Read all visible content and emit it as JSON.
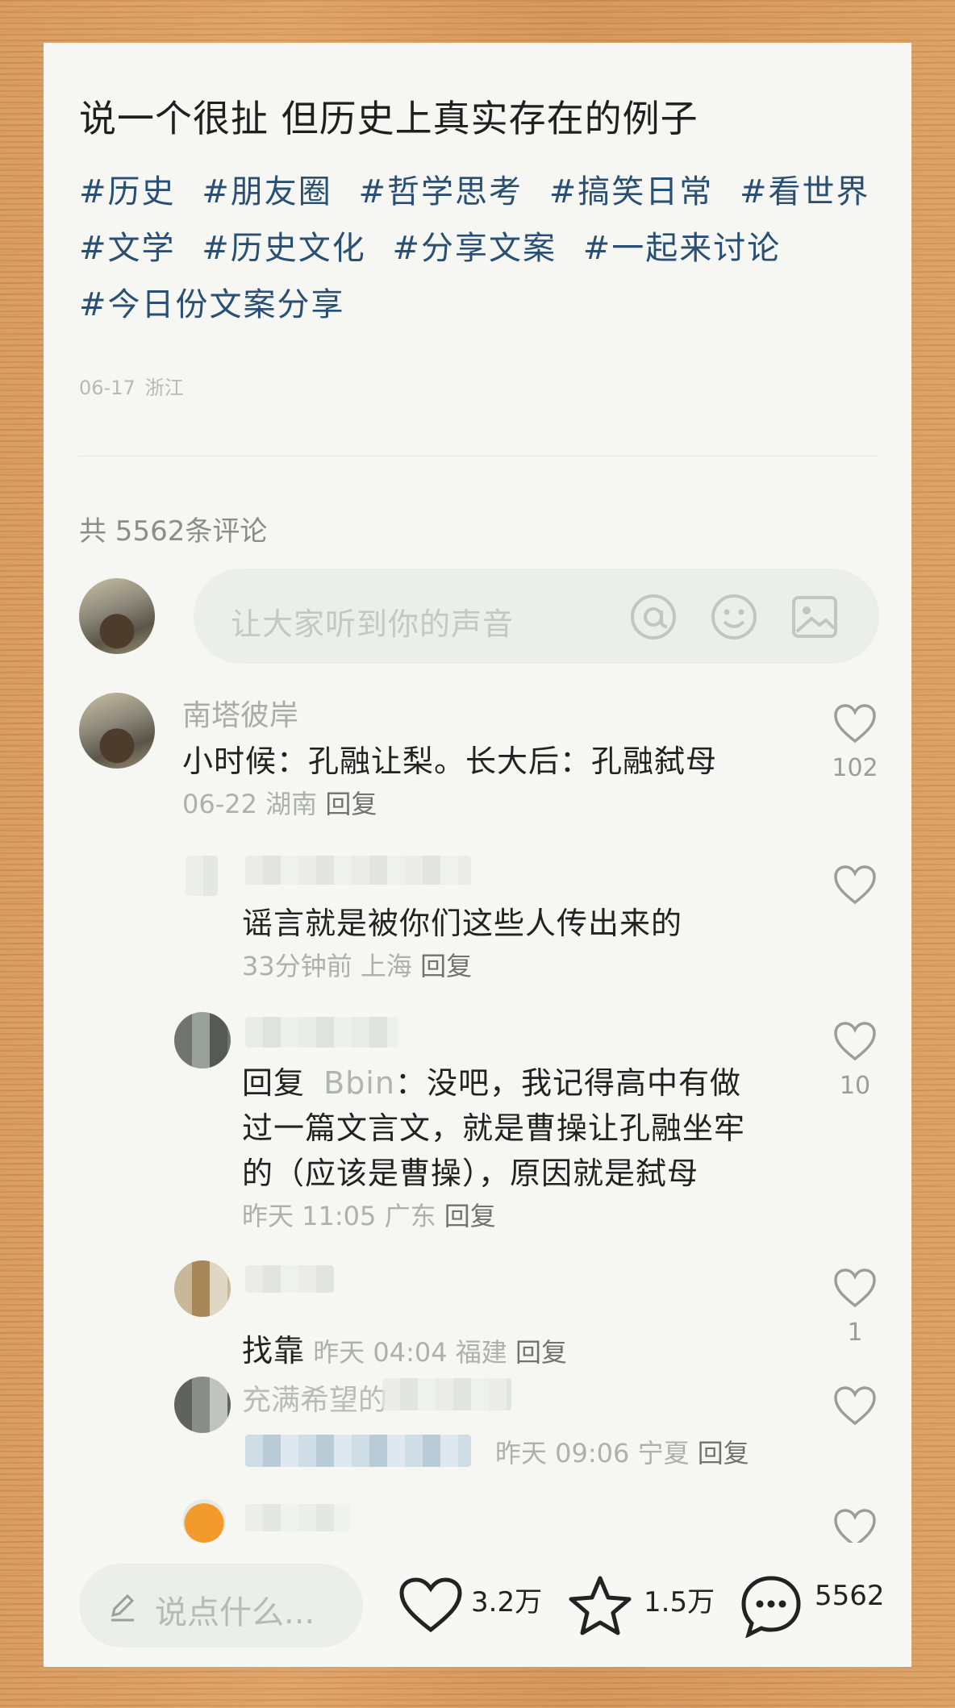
{
  "post": {
    "title": "说一个很扯 但历史上真实存在的例子",
    "tags": [
      "#历史",
      "#朋友圈",
      "#哲学思考",
      "#搞笑日常",
      "#看世界",
      "#文学",
      "#历史文化",
      "#分享文案",
      "#一起来讨论",
      "#今日份文案分享"
    ],
    "date": "06-17",
    "location": "浙江"
  },
  "comments_header": {
    "count_text": "共 5562条评论"
  },
  "comment_input": {
    "placeholder": "让大家听到你的声音",
    "icons": [
      "at-icon",
      "emoji-icon",
      "image-icon"
    ]
  },
  "comments": [
    {
      "name": "南塔彼岸",
      "text": "小时候：孔融让梨。长大后：孔融弑母",
      "time": "06-22",
      "location": "湖南",
      "reply": "回复",
      "likes": "102"
    },
    {
      "text": "谣言就是被你们这些人传出来的",
      "time": "33分钟前",
      "location": "上海",
      "reply": "回复",
      "likes": ""
    },
    {
      "reply_prefix": "回复",
      "reply_to": "Bbin",
      "text_lines": [
        "：没吧，我记得高中有做",
        "过一篇文言文，就是曹操让孔融坐牢",
        "的（应该是曹操），原因就是弑母"
      ],
      "time": "昨天 11:05",
      "location": "广东",
      "reply": "回复",
      "likes": "10"
    },
    {
      "text": "找靠",
      "time": "昨天 04:04",
      "location": "福建",
      "reply": "回复",
      "likes": "1"
    },
    {
      "name_partial": "充满希望的",
      "time": "昨天 09:06",
      "location": "宁夏",
      "reply": "回复",
      "likes": ""
    }
  ],
  "bottom_bar": {
    "say_placeholder": "说点什么...",
    "likes": "3.2万",
    "favorites": "1.5万",
    "comments": "5562"
  },
  "colors": {
    "tag": "#294f73",
    "card": "#f6f7f2",
    "background": "#d79a5d"
  }
}
